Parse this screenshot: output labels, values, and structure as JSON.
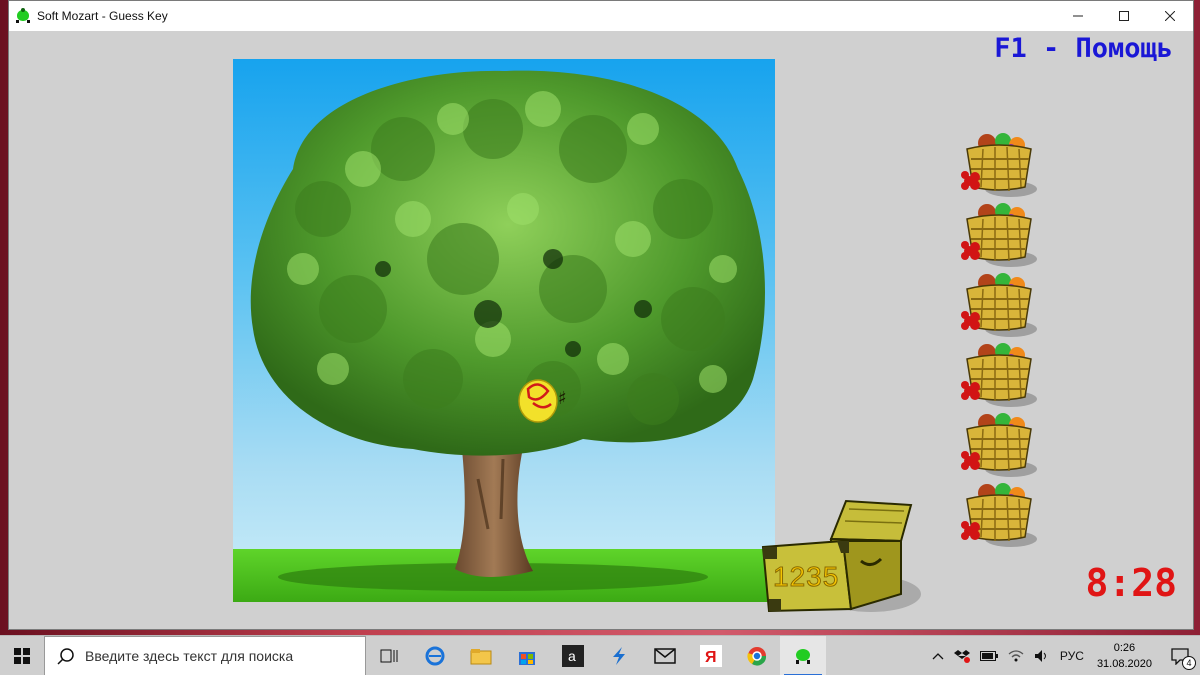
{
  "window": {
    "title": "Soft Mozart - Guess Key",
    "controls": [
      "minimize",
      "maximize",
      "close"
    ]
  },
  "game": {
    "help_hint": "F1 - Помощь",
    "chest_number": "1235",
    "timer": "8:28",
    "baskets_count": 6,
    "note_on_tree": "♯"
  },
  "taskbar": {
    "search_placeholder": "Введите здесь текст для поиска",
    "apps": [
      "task-view",
      "edge",
      "file-explorer",
      "store",
      "amazon",
      "sway",
      "mail",
      "yandex",
      "chrome",
      "soft-mozart"
    ],
    "language": "РУС",
    "time": "0:26",
    "date": "31.08.2020",
    "notifications": "4"
  },
  "colors": {
    "help_text": "#1a17d6",
    "timer": "#e01515",
    "chest_digits": "#f5c400"
  }
}
